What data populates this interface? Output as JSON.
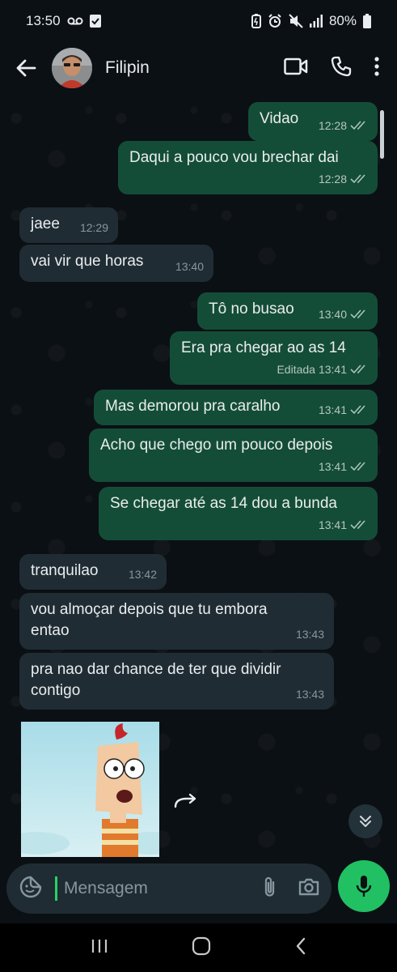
{
  "status_bar": {
    "time": "13:50",
    "battery": "80%"
  },
  "header": {
    "contact_name": "Filipin"
  },
  "messages": [
    {
      "dir": "out",
      "text": "Vidao",
      "time": "12:28"
    },
    {
      "dir": "out",
      "text": "Daqui a pouco vou brechar dai",
      "time": "12:28"
    },
    {
      "dir": "in",
      "text": "jaee",
      "time": "12:29"
    },
    {
      "dir": "in",
      "text": "vai vir que horas",
      "time": "13:40"
    },
    {
      "dir": "out",
      "text": "Tô no busao",
      "time": "13:40"
    },
    {
      "dir": "out",
      "text": "Era pra chegar ao as 14",
      "time": "13:41",
      "edited": "Editada"
    },
    {
      "dir": "out",
      "text": "Mas demorou pra caralho",
      "time": "13:41"
    },
    {
      "dir": "out",
      "text": "Acho que chego um pouco depois",
      "time": "13:41"
    },
    {
      "dir": "out",
      "text": "Se chegar até as 14 dou a bunda",
      "time": "13:41"
    },
    {
      "dir": "in",
      "text": "tranquilao",
      "time": "13:42"
    },
    {
      "dir": "in",
      "text": "vou almoçar depois que tu embora entao",
      "time": "13:43"
    },
    {
      "dir": "in",
      "text": "pra nao dar chance de ter que dividir contigo",
      "time": "13:43"
    }
  ],
  "composer": {
    "placeholder": "Mensagem"
  },
  "colors": {
    "outgoing_bubble": "#144d37",
    "incoming_bubble": "#202c33",
    "accent": "#21c063",
    "read_ticks": "#a8c5b8"
  }
}
